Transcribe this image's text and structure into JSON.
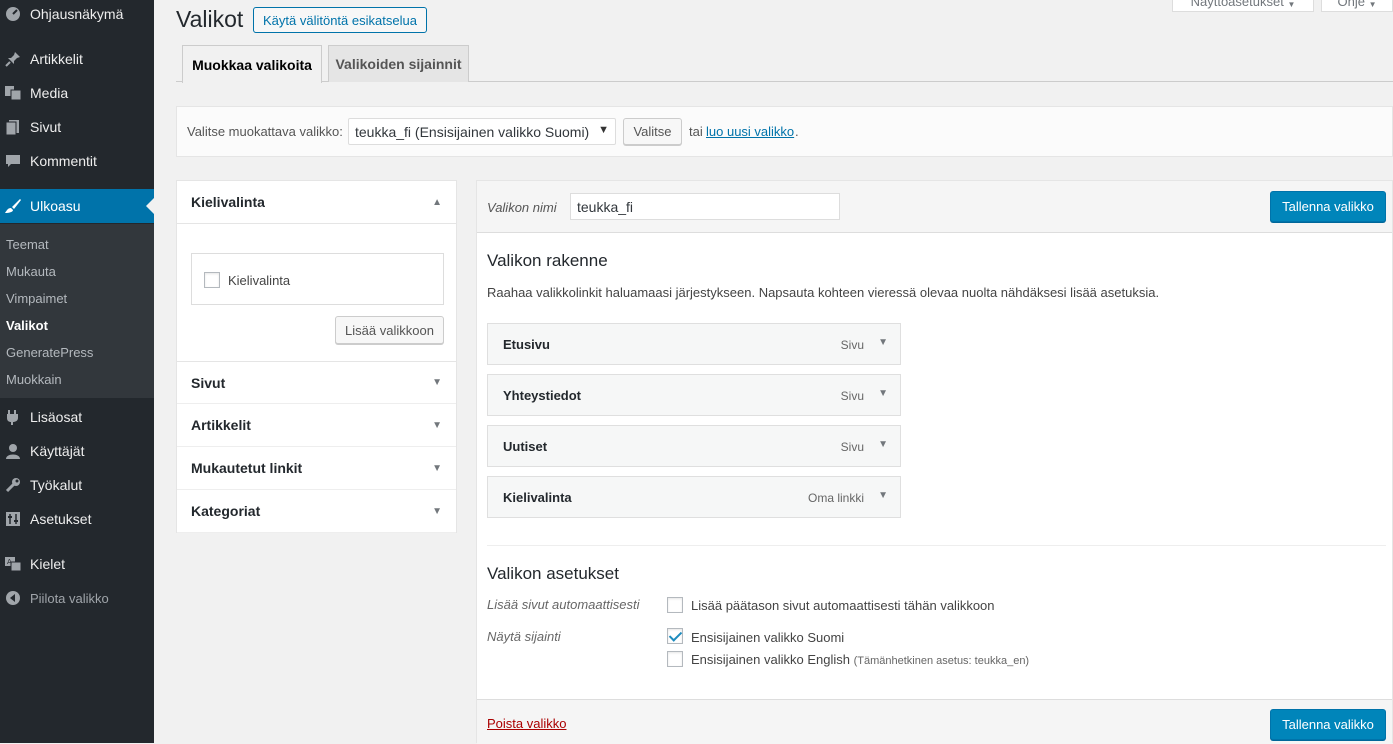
{
  "sidebar": {
    "items": [
      {
        "label": "Ohjausnäkymä",
        "icon": "dashboard-icon"
      },
      {
        "label": "Artikkelit",
        "icon": "pin-icon"
      },
      {
        "label": "Media",
        "icon": "media-icon"
      },
      {
        "label": "Sivut",
        "icon": "pages-icon"
      },
      {
        "label": "Kommentit",
        "icon": "comments-icon"
      },
      {
        "label": "Ulkoasu",
        "icon": "brush-icon"
      },
      {
        "label": "Lisäosat",
        "icon": "plugins-icon"
      },
      {
        "label": "Käyttäjät",
        "icon": "users-icon"
      },
      {
        "label": "Työkalut",
        "icon": "tools-icon"
      },
      {
        "label": "Asetukset",
        "icon": "settings-icon"
      },
      {
        "label": "Kielet",
        "icon": "translation-icon"
      },
      {
        "label": "Piilota valikko",
        "icon": "collapse-icon"
      }
    ],
    "submenu": [
      "Teemat",
      "Mukauta",
      "Vimpaimet",
      "Valikot",
      "GeneratePress",
      "Muokkain"
    ]
  },
  "header": {
    "title": "Valikot",
    "preview_label": "Käytä välitöntä esikatselua",
    "screen_options": "Näyttöasetukset",
    "help": "Ohje"
  },
  "tabs": [
    {
      "label": "Muokkaa valikoita",
      "active": true
    },
    {
      "label": "Valikoiden sijainnit",
      "active": false
    }
  ],
  "manage": {
    "label": "Valitse muokattava valikko:",
    "selected": "teukka_fi (Ensisijainen valikko Suomi)",
    "select_button": "Valitse",
    "or": "tai",
    "create_link": "luo uusi valikko",
    "dot": "."
  },
  "accordion": {
    "open_section": "Kielivalinta",
    "checkbox_label": "Kielivalinta",
    "add_button": "Lisää valikkoon",
    "sections": [
      "Sivut",
      "Artikkelit",
      "Mukautetut linkit",
      "Kategoriat"
    ]
  },
  "editor": {
    "name_label": "Valikon nimi",
    "name_value": "teukka_fi",
    "save_label": "Tallenna valikko",
    "structure_title": "Valikon rakenne",
    "structure_desc": "Raahaa valikkolinkit haluamaasi järjestykseen. Napsauta kohteen vieressä olevaa nuolta nähdäksesi lisää asetuksia.",
    "items": [
      {
        "title": "Etusivu",
        "type": "Sivu"
      },
      {
        "title": "Yhteystiedot",
        "type": "Sivu"
      },
      {
        "title": "Uutiset",
        "type": "Sivu"
      },
      {
        "title": "Kielivalinta",
        "type": "Oma linkki"
      }
    ],
    "settings_title": "Valikon asetukset",
    "auto_add_label": "Lisää sivut automaattisesti",
    "auto_add_text": "Lisää päätason sivut automaattisesti tähän valikkoon",
    "location_label": "Näytä sijainti",
    "locations": [
      {
        "label": "Ensisijainen valikko Suomi",
        "checked": true,
        "note": ""
      },
      {
        "label": "Ensisijainen valikko English",
        "checked": false,
        "note": "(Tämänhetkinen asetus: teukka_en)"
      }
    ],
    "delete_label": "Poista valikko"
  },
  "colors": {
    "sidebar_bg": "#23282d",
    "accent": "#0073aa",
    "primary_button": "#0085ba",
    "delete": "#aa0000"
  }
}
